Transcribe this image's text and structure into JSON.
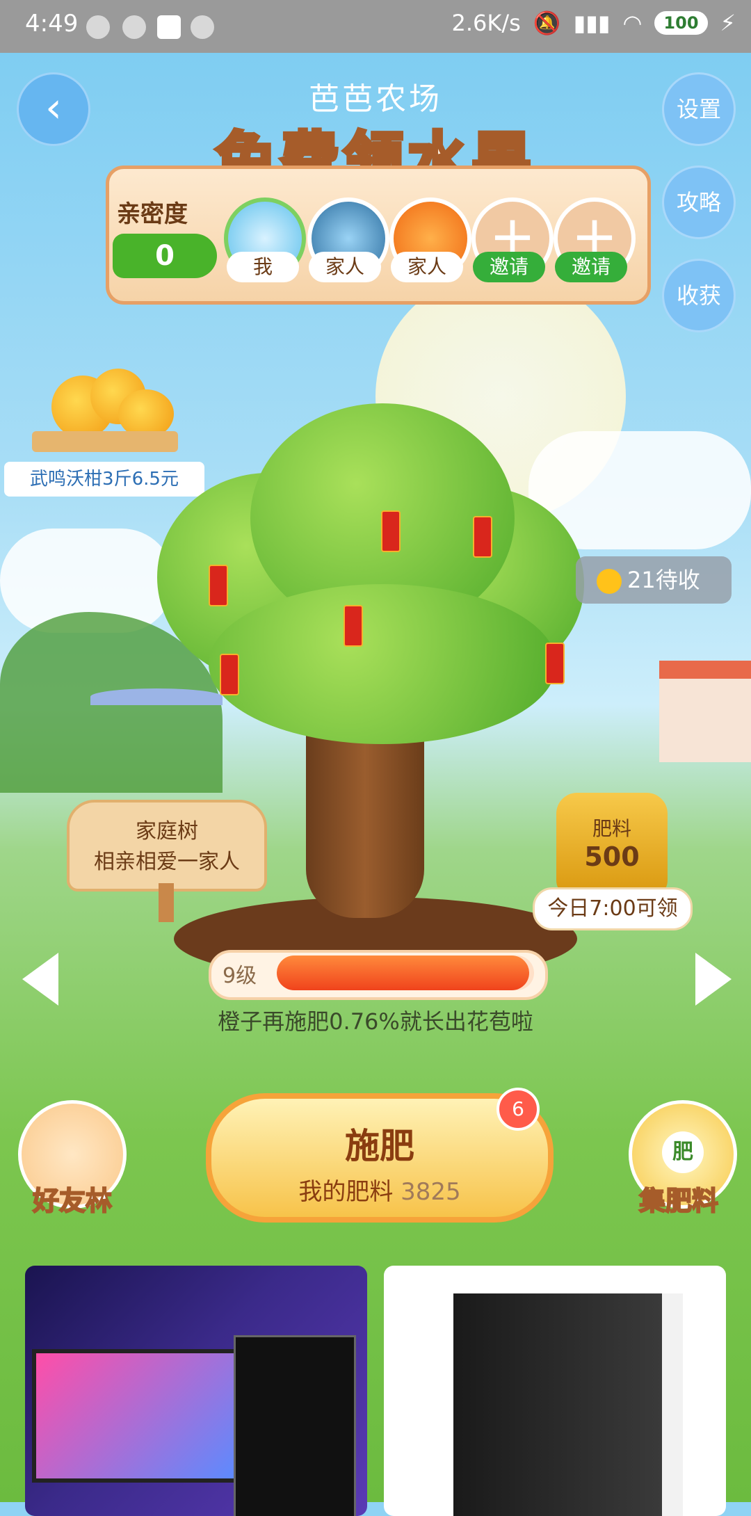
{
  "status_bar": {
    "time": "4:49",
    "speed": "2.6K/s",
    "battery": "100"
  },
  "header": {
    "subtitle": "芭芭农场",
    "title": "免费领水果",
    "side_buttons": [
      "设置",
      "攻略",
      "收获"
    ]
  },
  "family": {
    "intimacy_label": "亲密度",
    "intimacy_value": "0",
    "members": [
      {
        "label": "我"
      },
      {
        "label": "家人"
      },
      {
        "label": "家人"
      },
      {
        "label": "邀请"
      },
      {
        "label": "邀请"
      }
    ]
  },
  "promo": {
    "label": "武鸣沃柑3斤6.5元"
  },
  "pending": {
    "label": "21待收"
  },
  "family_tree_sign": {
    "line1": "家庭树",
    "line2": "相亲相爱一家人"
  },
  "fertilizer_bag": {
    "name": "肥料",
    "amount": "500",
    "tag": "今日7:00可领"
  },
  "level": {
    "label": "9级",
    "progress": 0.98,
    "message": "橙子再施肥0.76%就长出花苞啦"
  },
  "actions": {
    "friends_forest": "好友林",
    "fertilize_title": "施肥",
    "fertilize_sub_label": "我的肥料",
    "fertilize_amount": "3825",
    "badge": "6",
    "collect_fertilizer": "集肥料",
    "collect_icon_char": "肥"
  },
  "colors": {
    "accent_green": "#35ae3a",
    "progress_orange": "#f0431c",
    "text_brown": "#6b3b16"
  }
}
